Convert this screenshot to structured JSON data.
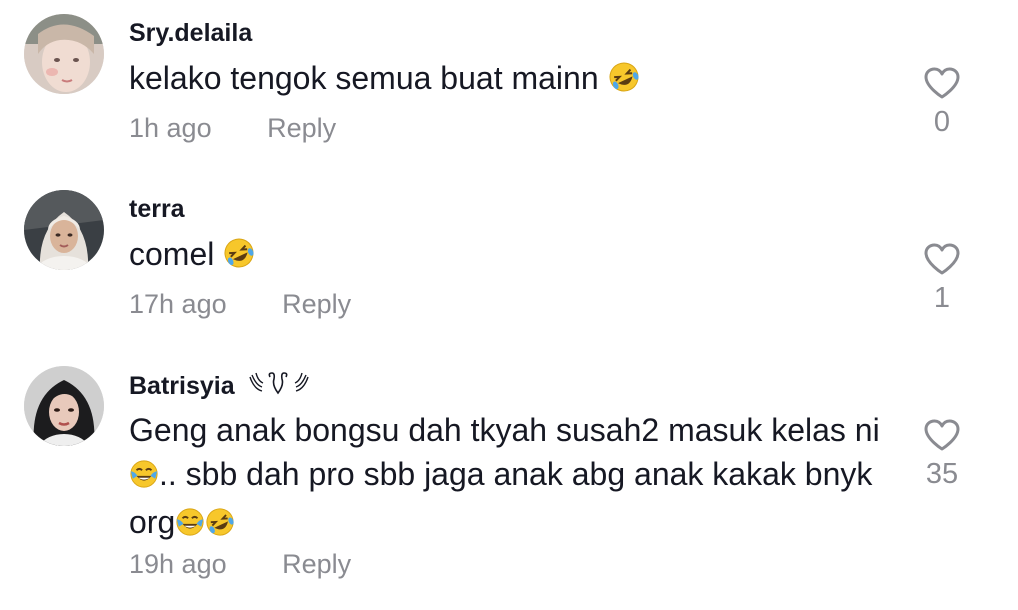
{
  "comments": [
    {
      "username": "Sry.delaila",
      "text": "kelako tengok semua buat mainn",
      "text_emoji": "rolling-on-floor-laughing-emoji",
      "time": "1h ago",
      "reply_label": "Reply",
      "likes": "0"
    },
    {
      "username": "terra",
      "text": "comel",
      "text_emoji": "rolling-on-floor-laughing-emoji",
      "time": "17h ago",
      "reply_label": "Reply",
      "likes": "1"
    },
    {
      "username": "Batrisyia",
      "username_suffix_icon": "winged-heart-doodle-icon",
      "text_parts": [
        "Geng anak bongsu dah tkyah susah2 masuk kelas ni",
        ".. sbb dah pro sbb jaga anak abg anak kakak bnyk org"
      ],
      "text_emojis": [
        "face-with-tears-of-joy-emoji",
        "face-with-tears-of-joy-emoji",
        "rolling-on-floor-laughing-emoji"
      ],
      "time": "19h ago",
      "reply_label": "Reply",
      "likes": "35"
    }
  ],
  "colors": {
    "username": "#161823",
    "meta": "#8a8b91",
    "emoji_yellow": "#f7c72b",
    "emoji_tear": "#4fa7e8"
  },
  "icons": {
    "like": "heart-outline-icon"
  }
}
